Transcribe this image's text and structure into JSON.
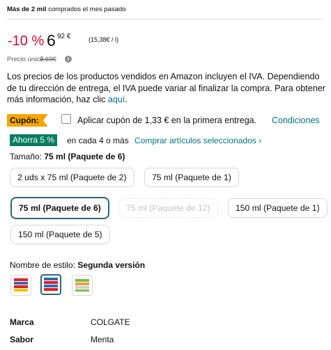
{
  "social_proof": {
    "bold": "Más de 2 mil",
    "rest": " comprados el mes pasado"
  },
  "price": {
    "discount": "-10 %",
    "whole": "6",
    "fraction": "92 €",
    "per_unit": "(15,38€ / l)",
    "unit_label": "Precio único:",
    "list_price": "7,69€",
    "info_icon": "i"
  },
  "vat_notice": {
    "text": "Los precios de los productos vendidos en Amazon incluyen el IVA. Dependiendo de tu dirección de entrega, el IVA puede variar al finalizar la compra. Para obtener más información, haz clic ",
    "link": "aquí",
    "end": "."
  },
  "coupon": {
    "badge": "Cupón:",
    "checkbox_label": "Aplicar cupón de 1,33 € en la primera entrega.",
    "conditions": "Condiciones"
  },
  "save_offer": {
    "badge": "Ahorra 5 %",
    "text": "en cada 4 o más",
    "link": "Comprar artículos seleccionados ›"
  },
  "size": {
    "label": "Tamaño:",
    "selected": "75 ml (Paquete de 6)",
    "options": [
      {
        "label": "2 uds x 75 ml (Paquete de 2)",
        "state": "available"
      },
      {
        "label": "75 ml (Paquete de 1)",
        "state": "available"
      },
      {
        "label": "75 ml (Paquete de 6)",
        "state": "selected"
      },
      {
        "label": "75 ml (Paquete de 12)",
        "state": "unavailable"
      },
      {
        "label": "150 ml (Paquete de 1)",
        "state": "available"
      },
      {
        "label": "150 ml (Paquete de 5)",
        "state": "available"
      }
    ]
  },
  "style": {
    "label": "Nombre de estilo:",
    "selected": "Segunda versión",
    "thumbnails": [
      {
        "icon": "toothpaste-pack-thumbnail",
        "selected": false
      },
      {
        "icon": "toothpaste-pack-thumbnail",
        "selected": true
      },
      {
        "icon": "toothpaste-pack-thumbnail",
        "selected": false
      }
    ]
  },
  "specs": [
    {
      "key": "Marca",
      "value": "COLGATE"
    },
    {
      "key": "Sabor",
      "value": "Menta"
    }
  ],
  "colors": {
    "discount": "#cc0c39",
    "link": "#007185",
    "coupon": "#f7a600",
    "save_badge": "#067d62",
    "selected_border": "#2b6776"
  }
}
